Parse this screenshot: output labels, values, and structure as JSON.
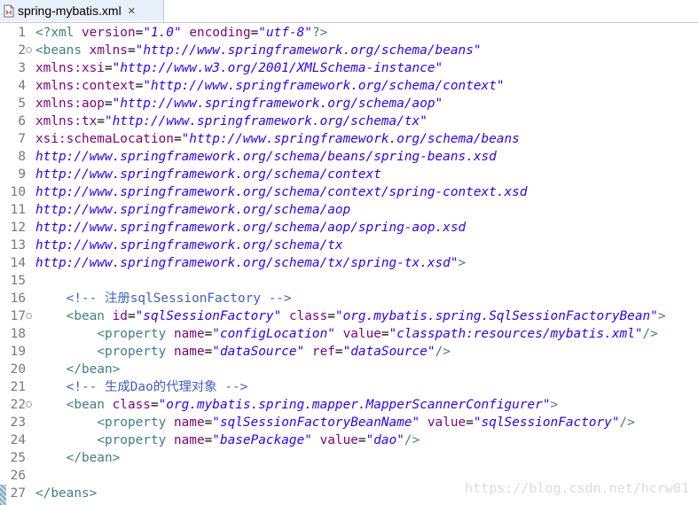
{
  "tab": {
    "title": "spring-mybatis.xml",
    "close": "✕",
    "icon": "xml-file-icon"
  },
  "watermark": "https://blog.csdn.net/hcrw01",
  "lines": [
    {
      "n": "1",
      "fold": false,
      "tokens": [
        [
          "c-tag",
          "<?xml "
        ],
        [
          "c-attr",
          "version"
        ],
        [
          "c-txt",
          "="
        ],
        [
          "c-str",
          "\"1.0\""
        ],
        [
          "c-txt",
          " "
        ],
        [
          "c-attr",
          "encoding"
        ],
        [
          "c-txt",
          "="
        ],
        [
          "c-str",
          "\"utf-8\""
        ],
        [
          "c-tag",
          "?>"
        ]
      ]
    },
    {
      "n": "2",
      "fold": true,
      "tokens": [
        [
          "c-tag",
          "<beans "
        ],
        [
          "c-attr",
          "xmlns"
        ],
        [
          "c-txt",
          "="
        ],
        [
          "c-str",
          "\"http://www.springframework.org/schema/beans\""
        ]
      ]
    },
    {
      "n": "3",
      "fold": false,
      "tokens": [
        [
          "c-attr",
          "xmlns:xsi"
        ],
        [
          "c-txt",
          "="
        ],
        [
          "c-str",
          "\"http://www.w3.org/2001/XMLSchema-instance\""
        ]
      ]
    },
    {
      "n": "4",
      "fold": false,
      "tokens": [
        [
          "c-attr",
          "xmlns:context"
        ],
        [
          "c-txt",
          "="
        ],
        [
          "c-str",
          "\"http://www.springframework.org/schema/context\""
        ]
      ]
    },
    {
      "n": "5",
      "fold": false,
      "tokens": [
        [
          "c-attr",
          "xmlns:aop"
        ],
        [
          "c-txt",
          "="
        ],
        [
          "c-str",
          "\"http://www.springframework.org/schema/aop\""
        ]
      ]
    },
    {
      "n": "6",
      "fold": false,
      "tokens": [
        [
          "c-attr",
          "xmlns:tx"
        ],
        [
          "c-txt",
          "="
        ],
        [
          "c-str",
          "\"http://www.springframework.org/schema/tx\""
        ]
      ]
    },
    {
      "n": "7",
      "fold": false,
      "tokens": [
        [
          "c-attr",
          "xsi:schemaLocation"
        ],
        [
          "c-txt",
          "="
        ],
        [
          "c-str",
          "\"http://www.springframework.org/schema/beans"
        ]
      ]
    },
    {
      "n": "8",
      "fold": false,
      "tokens": [
        [
          "c-str",
          "http://www.springframework.org/schema/beans/spring-beans.xsd"
        ]
      ]
    },
    {
      "n": "9",
      "fold": false,
      "tokens": [
        [
          "c-str",
          "http://www.springframework.org/schema/context"
        ]
      ]
    },
    {
      "n": "10",
      "fold": false,
      "tokens": [
        [
          "c-str",
          "http://www.springframework.org/schema/context/spring-context.xsd"
        ]
      ]
    },
    {
      "n": "11",
      "fold": false,
      "tokens": [
        [
          "c-str",
          "http://www.springframework.org/schema/aop"
        ]
      ]
    },
    {
      "n": "12",
      "fold": false,
      "tokens": [
        [
          "c-str",
          "http://www.springframework.org/schema/aop/spring-aop.xsd"
        ]
      ]
    },
    {
      "n": "13",
      "fold": false,
      "tokens": [
        [
          "c-str",
          "http://www.springframework.org/schema/tx"
        ]
      ]
    },
    {
      "n": "14",
      "fold": false,
      "tokens": [
        [
          "c-str",
          "http://www.springframework.org/schema/tx/spring-tx.xsd\""
        ],
        [
          "c-tag",
          ">"
        ]
      ]
    },
    {
      "n": "15",
      "fold": false,
      "tokens": []
    },
    {
      "n": "16",
      "fold": false,
      "tokens": [
        [
          "c-txt",
          "    "
        ],
        [
          "c-cmt",
          "<!-- 注册sqlSessionFactory -->"
        ]
      ]
    },
    {
      "n": "17",
      "fold": true,
      "tokens": [
        [
          "c-txt",
          "    "
        ],
        [
          "c-tag",
          "<bean "
        ],
        [
          "c-attr",
          "id"
        ],
        [
          "c-txt",
          "="
        ],
        [
          "c-str",
          "\"sqlSessionFactory\""
        ],
        [
          "c-txt",
          " "
        ],
        [
          "c-attr",
          "class"
        ],
        [
          "c-txt",
          "="
        ],
        [
          "c-str",
          "\"org.mybatis.spring.SqlSessionFactoryBean\""
        ],
        [
          "c-tag",
          ">"
        ]
      ]
    },
    {
      "n": "18",
      "fold": false,
      "tokens": [
        [
          "c-txt",
          "        "
        ],
        [
          "c-tag",
          "<property "
        ],
        [
          "c-attr",
          "name"
        ],
        [
          "c-txt",
          "="
        ],
        [
          "c-str",
          "\"configLocation\""
        ],
        [
          "c-txt",
          " "
        ],
        [
          "c-attr",
          "value"
        ],
        [
          "c-txt",
          "="
        ],
        [
          "c-str",
          "\"classpath:resources/mybatis.xml\""
        ],
        [
          "c-tag",
          "/>"
        ]
      ]
    },
    {
      "n": "19",
      "fold": false,
      "tokens": [
        [
          "c-txt",
          "        "
        ],
        [
          "c-tag",
          "<property "
        ],
        [
          "c-attr",
          "name"
        ],
        [
          "c-txt",
          "="
        ],
        [
          "c-str",
          "\"dataSource\""
        ],
        [
          "c-txt",
          " "
        ],
        [
          "c-attr",
          "ref"
        ],
        [
          "c-txt",
          "="
        ],
        [
          "c-str",
          "\"dataSource\""
        ],
        [
          "c-tag",
          "/>"
        ]
      ]
    },
    {
      "n": "20",
      "fold": false,
      "tokens": [
        [
          "c-txt",
          "    "
        ],
        [
          "c-tag",
          "</bean>"
        ]
      ]
    },
    {
      "n": "21",
      "fold": false,
      "tokens": [
        [
          "c-txt",
          "    "
        ],
        [
          "c-cmt",
          "<!-- 生成Dao的代理对象 -->"
        ]
      ]
    },
    {
      "n": "22",
      "fold": true,
      "tokens": [
        [
          "c-txt",
          "    "
        ],
        [
          "c-tag",
          "<bean "
        ],
        [
          "c-attr",
          "class"
        ],
        [
          "c-txt",
          "="
        ],
        [
          "c-str",
          "\"org.mybatis.spring.mapper.MapperScannerConfigurer\""
        ],
        [
          "c-tag",
          ">"
        ]
      ]
    },
    {
      "n": "23",
      "fold": false,
      "tokens": [
        [
          "c-txt",
          "        "
        ],
        [
          "c-tag",
          "<property "
        ],
        [
          "c-attr",
          "name"
        ],
        [
          "c-txt",
          "="
        ],
        [
          "c-str",
          "\"sqlSessionFactoryBeanName\""
        ],
        [
          "c-txt",
          " "
        ],
        [
          "c-attr",
          "value"
        ],
        [
          "c-txt",
          "="
        ],
        [
          "c-str",
          "\"sqlSessionFactory\""
        ],
        [
          "c-tag",
          "/>"
        ]
      ]
    },
    {
      "n": "24",
      "fold": false,
      "tokens": [
        [
          "c-txt",
          "        "
        ],
        [
          "c-tag",
          "<property "
        ],
        [
          "c-attr",
          "name"
        ],
        [
          "c-txt",
          "="
        ],
        [
          "c-str",
          "\"basePackage\""
        ],
        [
          "c-txt",
          " "
        ],
        [
          "c-attr",
          "value"
        ],
        [
          "c-txt",
          "="
        ],
        [
          "c-str",
          "\"dao\""
        ],
        [
          "c-tag",
          "/>"
        ]
      ]
    },
    {
      "n": "25",
      "fold": false,
      "tokens": [
        [
          "c-txt",
          "    "
        ],
        [
          "c-tag",
          "</bean>"
        ]
      ]
    },
    {
      "n": "26",
      "fold": false,
      "tokens": []
    },
    {
      "n": "27",
      "fold": false,
      "tokens": [
        [
          "c-tag",
          "</beans>"
        ]
      ]
    }
  ]
}
